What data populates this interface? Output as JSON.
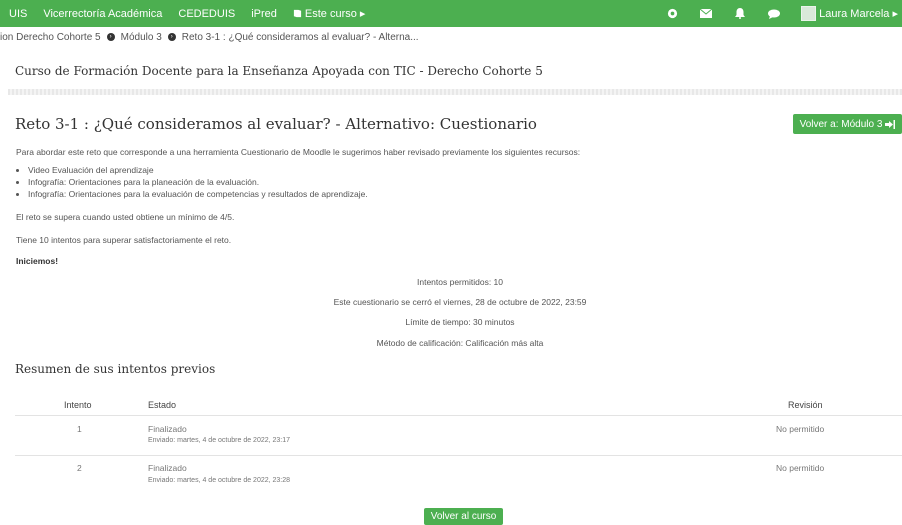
{
  "topbar": {
    "items": [
      "UIS",
      "Vicerrectoría Académica",
      "CEDEDUIS",
      "iPred",
      "Este curso ▸"
    ],
    "user_name": "Laura Marcela ▸"
  },
  "breadcrumb": {
    "items": [
      "ion Derecho Cohorte 5",
      "Módulo 3",
      "Reto 3-1 : ¿Qué consideramos al evaluar? - Alterna..."
    ]
  },
  "course": {
    "title": "Curso de Formación Docente para la Enseñanza Apoyada con TIC - Derecho Cohorte 5"
  },
  "page": {
    "heading": "Reto 3-1 : ¿Qué consideramos al evaluar? - Alternativo: Cuestionario",
    "back_button": "Volver a: Módulo 3",
    "intro": "Para abordar este reto que corresponde a una herramienta Cuestionario de Moodle le sugerimos haber revisado previamente los siguientes recursos:",
    "resources": [
      "Video Evaluación del aprendizaje",
      "Infografía: Orientaciones para la planeación de la evaluación.",
      "Infografía: Orientaciones para la evaluación de competencias y resultados de aprendizaje."
    ],
    "pass_note": "El reto se supera cuando usted obtiene un mínimo de 4/5.",
    "attempts_note": "Tiene 10 intentos para superar satisfactoriamente el reto.",
    "start": "Iniciemos!"
  },
  "quiz_info": {
    "attempts_allowed": "Intentos permitidos: 10",
    "closed": "Este cuestionario se cerró el viernes, 28 de octubre de 2022, 23:59",
    "time_limit": "Límite de tiempo: 30 minutos",
    "grading": "Método de calificación: Calificación más alta"
  },
  "summary": {
    "title": "Resumen de sus intentos previos",
    "headers": {
      "attempt": "Intento",
      "state": "Estado",
      "review": "Revisión"
    },
    "rows": [
      {
        "attempt": "1",
        "state": "Finalizado",
        "submitted": "Enviado: martes, 4 de octubre de 2022, 23:17",
        "review": "No permitido"
      },
      {
        "attempt": "2",
        "state": "Finalizado",
        "submitted": "Enviado: martes, 4 de octubre de 2022, 23:28",
        "review": "No permitido"
      }
    ]
  },
  "footer": {
    "back_to_course": "Volver al curso"
  },
  "icons": {
    "book": "book-icon",
    "help": "help-icon",
    "mail": "mail-icon",
    "bell": "bell-icon",
    "chat": "chat-icon",
    "exit": "exit-icon"
  },
  "colors": {
    "accent": "#4caf50"
  }
}
